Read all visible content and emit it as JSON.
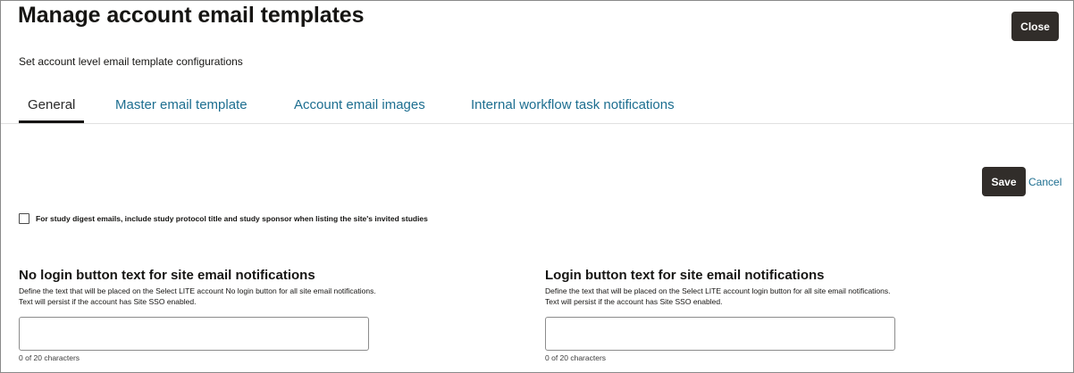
{
  "header": {
    "title": "Manage account email templates",
    "close_label": "Close",
    "subtitle": "Set account level email template configurations"
  },
  "tabs": [
    {
      "label": "General",
      "active": true
    },
    {
      "label": "Master email template",
      "active": false
    },
    {
      "label": "Account email images",
      "active": false
    },
    {
      "label": "Internal workflow task notifications",
      "active": false
    }
  ],
  "actions": {
    "save_label": "Save",
    "cancel_label": "Cancel"
  },
  "digest_option": {
    "label": "For study digest emails, include study protocol title and study sponsor when listing the site's invited studies",
    "checked": false
  },
  "no_login_section": {
    "title": "No login button text for site email notifications",
    "description": "Define the text that will be placed on the Select LITE account No login button for all site email notifications. Text will persist if the account has Site SSO enabled.",
    "value": "",
    "char_count": "0 of 20 characters"
  },
  "login_section": {
    "title": "Login button text for site email notifications",
    "description": "Define the text that will be placed on the Select LITE account login button for all site email notifications. Text will persist if the account has Site SSO enabled.",
    "value": "",
    "char_count": "0 of 20 characters"
  },
  "colors": {
    "primary_button": "#312d2a",
    "link": "#1d6e90",
    "text": "#161513"
  }
}
